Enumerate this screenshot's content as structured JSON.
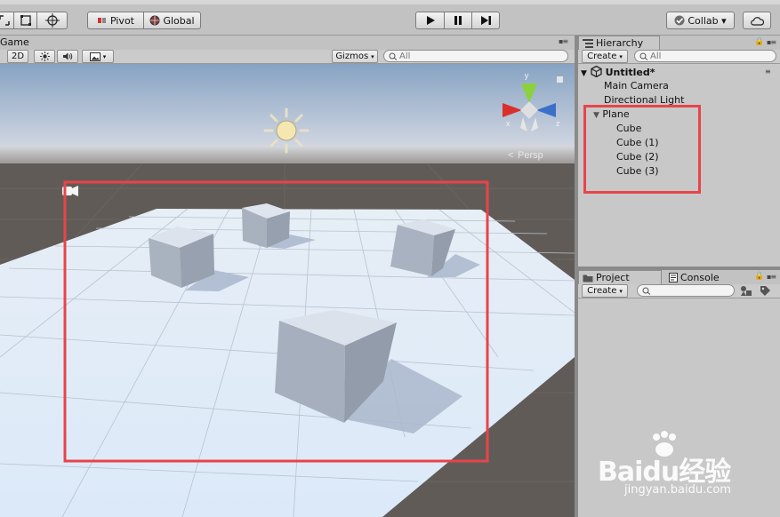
{
  "toolbar": {
    "pivot_label": "Pivot",
    "global_label": "Global",
    "collab_label": "Collab ▾"
  },
  "game_panel": {
    "tab_label": "Game",
    "mode_2d_label": "2D",
    "gizmos_label": "Gizmos",
    "search_placeholder": "All",
    "persp_label": "Persp",
    "gizmo_axes": {
      "y": "y",
      "x": "x",
      "z": "z"
    }
  },
  "hierarchy": {
    "tab_label": "Hierarchy",
    "create_label": "Create",
    "search_placeholder": "All",
    "scene_name": "Untitled*",
    "items": [
      {
        "label": "Main Camera",
        "depth": 0
      },
      {
        "label": "Directional Light",
        "depth": 0
      },
      {
        "label": "Plane",
        "depth": 0,
        "expanded": true
      },
      {
        "label": "Cube",
        "depth": 1
      },
      {
        "label": "Cube (1)",
        "depth": 1
      },
      {
        "label": "Cube (2)",
        "depth": 1
      },
      {
        "label": "Cube (3)",
        "depth": 1
      }
    ]
  },
  "project": {
    "tab_label": "Project",
    "console_tab_label": "Console",
    "create_label": "Create"
  },
  "watermark": {
    "brand_text": "Baidu经验",
    "url_text": "jingyan.baidu.com"
  },
  "colors": {
    "highlight_box": "#e8444a",
    "sky_top": "#8aa4c1",
    "ground": "#5f5a56",
    "plane": "#dbeaf8"
  }
}
